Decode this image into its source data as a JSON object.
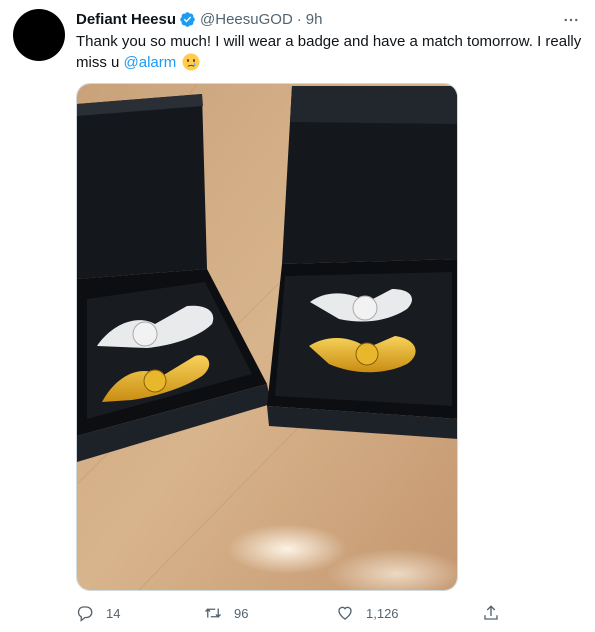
{
  "tweet": {
    "author_name": "Defiant Heesu",
    "handle": "@HeesuGOD",
    "separator": "·",
    "time": "9h",
    "text_before_mention": "Thank you so much! I will wear a badge and have a match tomorrow. I really miss u ",
    "mention": "@alarm",
    "emoji": "crying-face-emoji",
    "image_alt": "Two black jewelry boxes with winged 17 badges"
  },
  "actions": {
    "reply_count": "14",
    "retweet_count": "96",
    "like_count": "1,126"
  },
  "colors": {
    "accent": "#1d9bf0",
    "muted": "#536471",
    "text": "#0f1419"
  },
  "icons": [
    "verified-badge-icon",
    "more-icon",
    "reply-icon",
    "retweet-icon",
    "like-icon",
    "share-icon"
  ]
}
